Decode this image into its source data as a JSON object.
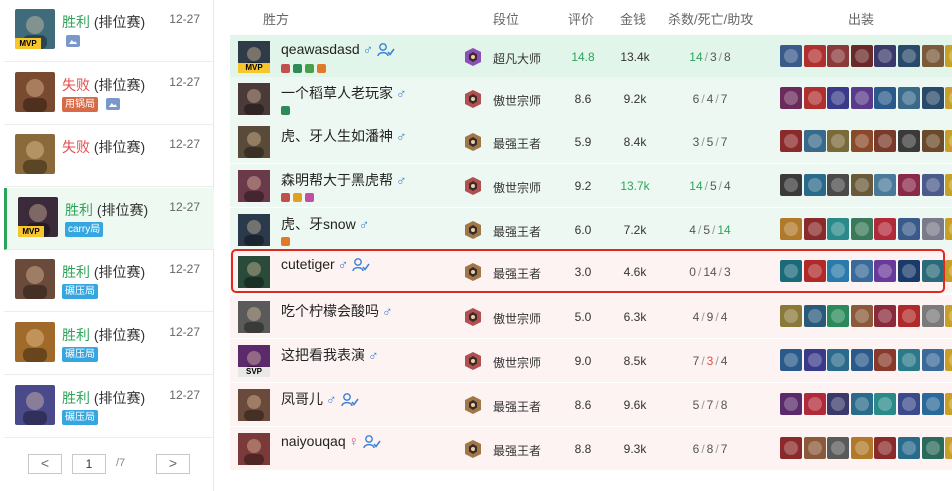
{
  "history": {
    "items": [
      {
        "result": "胜利",
        "mode": " (排位赛)",
        "date": "12-27",
        "outcome": "win",
        "mvp": true,
        "mvp_label": "MVP",
        "tag": "",
        "has_image": true,
        "avatar_color": "#3f6b7a"
      },
      {
        "result": "失败",
        "mode": " (排位赛)",
        "date": "12-27",
        "outcome": "lose",
        "mvp": false,
        "tag": "用锅局",
        "tag_style": "orange",
        "has_image": true,
        "avatar_color": "#7a4a30"
      },
      {
        "result": "失败",
        "mode": " (排位赛)",
        "date": "12-27",
        "outcome": "lose",
        "mvp": false,
        "tag": "",
        "has_image": false,
        "avatar_color": "#8a6a3a"
      },
      {
        "result": "胜利",
        "mode": " (排位赛)",
        "date": "12-27",
        "outcome": "win",
        "mvp": true,
        "mvp_label": "MVP",
        "tag": "carry局",
        "tag_style": "blue",
        "has_image": false,
        "avatar_color": "#3a2a3a",
        "selected": true
      },
      {
        "result": "胜利",
        "mode": " (排位赛)",
        "date": "12-27",
        "outcome": "win",
        "mvp": false,
        "tag": "碾压局",
        "tag_style": "blue",
        "has_image": false,
        "avatar_color": "#6a4a3a"
      },
      {
        "result": "胜利",
        "mode": " (排位赛)",
        "date": "12-27",
        "outcome": "win",
        "mvp": false,
        "tag": "碾压局",
        "tag_style": "blue",
        "has_image": false,
        "avatar_color": "#a06a2a"
      },
      {
        "result": "胜利",
        "mode": " (排位赛)",
        "date": "12-27",
        "outcome": "win",
        "mvp": false,
        "tag": "碾压局",
        "tag_style": "blue",
        "has_image": false,
        "avatar_color": "#4a4a8a"
      }
    ],
    "pager": {
      "prev": "<",
      "next": ">",
      "current": "1",
      "total": "/7"
    }
  },
  "header": {
    "team": "胜方",
    "rank": "段位",
    "score": "评价",
    "gold": "金钱",
    "kda": "杀数/死亡/助攻",
    "items": "出装"
  },
  "players": [
    {
      "name": "qeawasdasd",
      "gender": "♂",
      "friend": true,
      "badge": "MVP",
      "row": "win-mvp",
      "champ_color": "#2f3b46",
      "rank": "超凡大师",
      "rank_color": "#8a4fb8",
      "score": "14.8",
      "score_hl": true,
      "gold": "13.4k",
      "gold_hl": false,
      "kills": "14",
      "deaths": "3",
      "assists": "8",
      "k_hl": true,
      "d_hl": false,
      "a_hl": false,
      "mini": [
        "#c0504d",
        "#2e8b57",
        "#4aa04a",
        "#e07a2a"
      ],
      "items": [
        "#3a5a8a",
        "#b03030",
        "#8a3a3a",
        "#6a2a2a",
        "#3a3a6a",
        "#2a4a6a",
        "#7a5a3a",
        "#c8a028"
      ]
    },
    {
      "name": "一个稻草人老玩家",
      "gender": "♂",
      "friend": false,
      "badge": "",
      "row": "win",
      "champ_color": "#4a3a3a",
      "rank": "傲世宗师",
      "rank_color": "#b05050",
      "score": "8.6",
      "score_hl": false,
      "gold": "9.2k",
      "gold_hl": false,
      "kills": "6",
      "deaths": "4",
      "assists": "7",
      "k_hl": false,
      "d_hl": false,
      "a_hl": false,
      "mini": [
        "#2e8b57"
      ],
      "items": [
        "#6a2a5a",
        "#b03030",
        "#3a3a8a",
        "#5a3a8a",
        "#2a5a8a",
        "#3a6a8a",
        "#2a4a6a",
        "#c8a028"
      ]
    },
    {
      "name": "虎、牙人生如潘神",
      "gender": "♂",
      "friend": false,
      "badge": "",
      "row": "win",
      "champ_color": "#5a4a3a",
      "rank": "最强王者",
      "rank_color": "#a07848",
      "score": "5.9",
      "score_hl": false,
      "gold": "8.4k",
      "gold_hl": false,
      "kills": "3",
      "deaths": "5",
      "assists": "7",
      "k_hl": false,
      "d_hl": false,
      "a_hl": false,
      "mini": [],
      "items": [
        "#8a2a2a",
        "#3a6a8a",
        "#7a6a3a",
        "#8a4a2a",
        "#7a3a2a",
        "#3a3a3a",
        "#6a4a2a",
        "#c8a028"
      ]
    },
    {
      "name": "森明帮大于黑虎帮",
      "gender": "♂",
      "friend": false,
      "badge": "",
      "row": "win",
      "champ_color": "#6a3a4a",
      "rank": "傲世宗师",
      "rank_color": "#b05050",
      "score": "9.2",
      "score_hl": false,
      "gold": "13.7k",
      "gold_hl": true,
      "kills": "14",
      "deaths": "5",
      "assists": "4",
      "k_hl": true,
      "d_hl": false,
      "a_hl": false,
      "mini": [
        "#c0504d",
        "#e0a020",
        "#c050a0"
      ],
      "items": [
        "#3a3a3a",
        "#2a6a8a",
        "#4a4a4a",
        "#6a5a3a",
        "#4a7a9a",
        "#8a2a4a",
        "#4a5a8a",
        "#c8a028"
      ]
    },
    {
      "name": "虎、牙snow",
      "gender": "♂",
      "friend": false,
      "badge": "",
      "row": "win",
      "champ_color": "#2a3a4a",
      "rank": "最强王者",
      "rank_color": "#a07848",
      "score": "6.0",
      "score_hl": false,
      "gold": "7.2k",
      "gold_hl": false,
      "kills": "4",
      "deaths": "5",
      "assists": "14",
      "k_hl": false,
      "d_hl": false,
      "a_hl": true,
      "mini": [
        "#e07a2a"
      ],
      "items": [
        "#b07a2a",
        "#8a2a2a",
        "#2a8a8a",
        "#3a7a5a",
        "#b02a3a",
        "#3a5a8a",
        "#7a7a8a",
        "#c8a028"
      ]
    },
    {
      "name": "cutetiger",
      "gender": "♂",
      "friend": true,
      "badge": "",
      "row": "lose",
      "champ_color": "#2a4a3a",
      "rank": "最强王者",
      "rank_color": "#a07848",
      "score": "3.0",
      "score_hl": false,
      "gold": "4.6k",
      "gold_hl": false,
      "kills": "0",
      "deaths": "14",
      "assists": "3",
      "k_hl": false,
      "d_hl": false,
      "a_hl": false,
      "mini": [],
      "items": [
        "#1a6a7a",
        "#b02a2a",
        "#2a7aaa",
        "#3a6a9a",
        "#6a3a9a",
        "#1a3a6a",
        "#2a6a7a",
        "#c8a028"
      ]
    },
    {
      "name": "吃个柠檬会酸吗",
      "gender": "♂",
      "friend": false,
      "badge": "",
      "row": "lose",
      "champ_color": "#5a5a5a",
      "rank": "傲世宗师",
      "rank_color": "#b05050",
      "score": "5.0",
      "score_hl": false,
      "gold": "6.3k",
      "gold_hl": false,
      "kills": "4",
      "deaths": "9",
      "assists": "4",
      "k_hl": false,
      "d_hl": false,
      "a_hl": false,
      "mini": [],
      "items": [
        "#8a7a3a",
        "#2a5a7a",
        "#2a8a5a",
        "#8a5a3a",
        "#8a2a3a",
        "#b02a2a",
        "#7a7a7a",
        "#c8a028"
      ]
    },
    {
      "name": "这把看我表演",
      "gender": "♂",
      "friend": false,
      "badge": "SVP",
      "row": "lose",
      "champ_color": "#5a2a6a",
      "rank": "傲世宗师",
      "rank_color": "#b05050",
      "score": "9.0",
      "score_hl": false,
      "gold": "8.5k",
      "gold_hl": false,
      "kills": "7",
      "deaths": "3",
      "assists": "4",
      "k_hl": false,
      "d_hl": true,
      "a_hl": false,
      "mini": [],
      "items": [
        "#2a5a8a",
        "#3a3a8a",
        "#2a6a8a",
        "#2a5a8a",
        "#8a3a2a",
        "#2a7a8a",
        "#3a6a9a",
        "#c8a028"
      ]
    },
    {
      "name": "凤哥儿",
      "gender": "♂",
      "friend": true,
      "badge": "",
      "row": "lose",
      "champ_color": "#6a4a3a",
      "rank": "最强王者",
      "rank_color": "#a07848",
      "score": "8.6",
      "score_hl": false,
      "gold": "9.6k",
      "gold_hl": false,
      "kills": "5",
      "deaths": "7",
      "assists": "8",
      "k_hl": false,
      "d_hl": false,
      "a_hl": false,
      "mini": [],
      "items": [
        "#5a2a6a",
        "#b02a3a",
        "#3a3a6a",
        "#2a6a8a",
        "#2a8a8a",
        "#3a4a8a",
        "#2a6a9a",
        "#c8a028"
      ]
    },
    {
      "name": "naiyouqaq",
      "gender": "♀",
      "friend": true,
      "badge": "",
      "row": "lose",
      "champ_color": "#7a3a3a",
      "rank": "最强王者",
      "rank_color": "#a07848",
      "score": "8.8",
      "score_hl": false,
      "gold": "9.3k",
      "gold_hl": false,
      "kills": "6",
      "deaths": "8",
      "assists": "7",
      "k_hl": false,
      "d_hl": false,
      "a_hl": false,
      "mini": [],
      "items": [
        "#8a2a2a",
        "#8a5a3a",
        "#5a5a5a",
        "#b07a2a",
        "#8a2a2a",
        "#2a6a8a",
        "#2a6a5a",
        "#c8a028"
      ]
    }
  ]
}
